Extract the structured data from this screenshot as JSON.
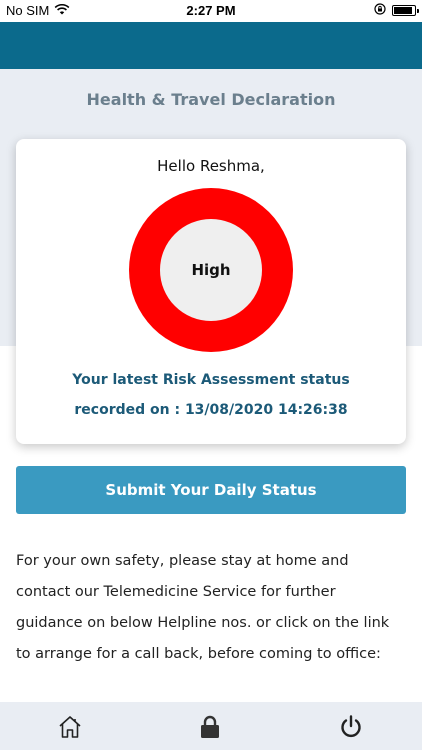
{
  "status_bar": {
    "carrier": "No SIM",
    "time": "2:27 PM"
  },
  "header": {
    "title": "Health & Travel Declaration"
  },
  "card": {
    "greeting": "Hello Reshma,",
    "risk_level": "High",
    "risk_color": "#ff0000",
    "status_line1": "Your latest Risk Assessment status",
    "status_line2": "recorded on : 13/08/2020 14:26:38"
  },
  "submit_button": {
    "label": "Submit Your Daily Status"
  },
  "info_text": "For your own safety, please stay at home and contact our Telemedicine Service for further guidance on below Helpline nos. or click on the link to arrange for a call back, before coming to office:",
  "bottom_nav": {
    "icons": [
      "home-icon",
      "lock-icon",
      "power-icon"
    ]
  }
}
